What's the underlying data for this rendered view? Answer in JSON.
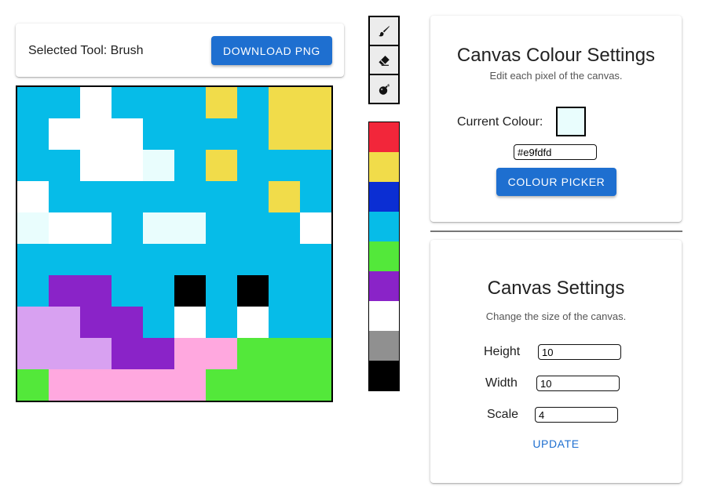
{
  "header": {
    "selected_tool_text": "Selected Tool: Brush",
    "download_label": "DOWNLOAD PNG"
  },
  "tools": [
    {
      "name": "brush-icon"
    },
    {
      "name": "eraser-icon"
    },
    {
      "name": "bomb-icon"
    }
  ],
  "palette": [
    "#f2263a",
    "#f1dc4a",
    "#0b2ed3",
    "#06bce8",
    "#53e83a",
    "#8a23c8",
    "#ffffff",
    "#909090",
    "#000000"
  ],
  "canvas": {
    "rows": 10,
    "cols": 10,
    "key": {
      "C": "#06bce8",
      "W": "#ffffff",
      "Y": "#f1dc4a",
      "L": "#e9fdfd",
      "P": "#8a23c8",
      "V": "#d8a1f1",
      "K": "#000000",
      "G": "#53e83a",
      "N": "#ffa8df"
    },
    "grid": [
      "CCWCCCYCYY",
      "CWWWCCCCYY",
      "CCWWLCYCCC",
      "WCCCCCCCYC",
      "LWWCLLCCCW",
      "CCCCCCCCCC",
      "CPPCCKCKCC",
      "VVPPCWCWCC",
      "VVVPPNNGGG",
      "GNNNNNGGGG"
    ]
  },
  "colour_settings": {
    "title": "Canvas Colour Settings",
    "subtitle": "Edit each pixel of the canvas.",
    "current_colour_label": "Current Colour:",
    "current_colour": "#e9fdfd",
    "hex_value": "#e9fdfd",
    "picker_label": "COLOUR PICKER"
  },
  "canvas_settings": {
    "title": "Canvas Settings",
    "subtitle": "Change the size of the canvas.",
    "height_label": "Height",
    "height_value": "10",
    "width_label": "Width",
    "width_value": "10",
    "scale_label": "Scale",
    "scale_value": "4",
    "update_label": "UPDATE"
  }
}
